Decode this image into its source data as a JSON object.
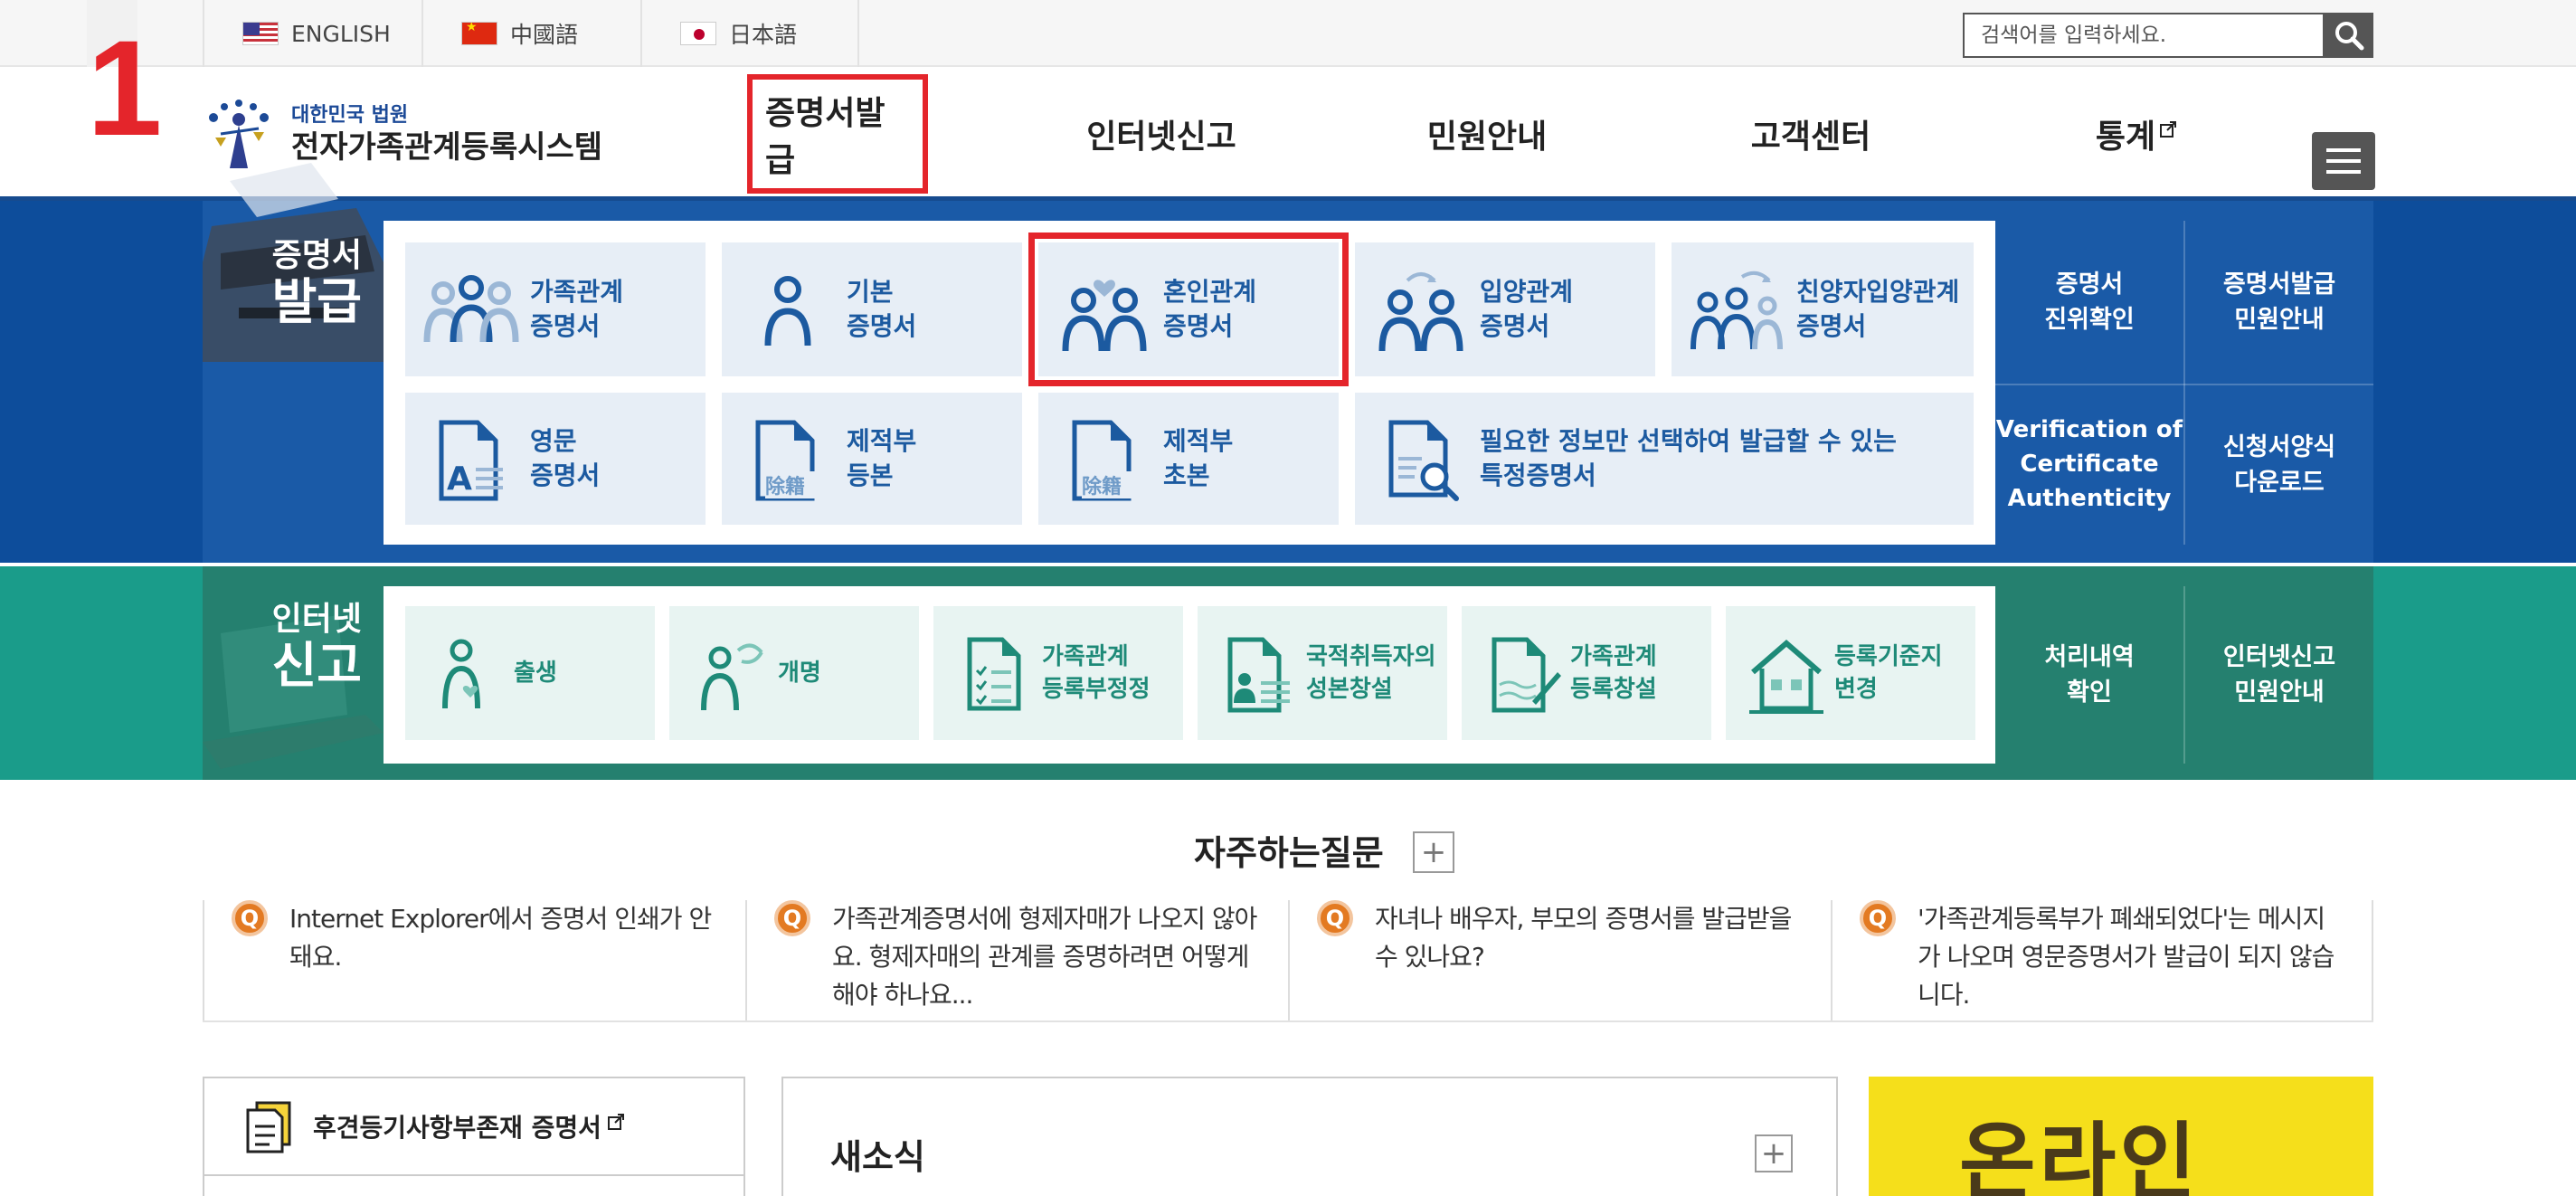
{
  "step_number": "1",
  "top": {
    "languages": [
      {
        "label": "ENGLISH",
        "flag": "us-flag-icon"
      },
      {
        "label": "中國語",
        "flag": "china-flag-icon"
      },
      {
        "label": "日本語",
        "flag": "japan-flag-icon"
      }
    ],
    "search": {
      "placeholder": "검색어를 입력하세요.",
      "icon": "search-icon"
    }
  },
  "header": {
    "logo_sub": "대한민국 법원",
    "logo_main": "전자가족관계등록시스템",
    "nav": [
      {
        "label": "증명서발급",
        "active": true
      },
      {
        "label": "인터넷신고",
        "active": false
      },
      {
        "label": "민원안내",
        "active": false
      },
      {
        "label": "고객센터",
        "active": false
      },
      {
        "label": "통계",
        "active": false,
        "external": true
      }
    ],
    "menu_icon": "hamburger-menu-icon"
  },
  "certificates": {
    "label_small": "증명서",
    "label_big": "발급",
    "tiles": [
      {
        "line1": "가족관계",
        "line2": "증명서",
        "icon": "family-icon",
        "selected": false
      },
      {
        "line1": "기본",
        "line2": "증명서",
        "icon": "person-icon",
        "selected": false
      },
      {
        "line1": "혼인관계",
        "line2": "증명서",
        "icon": "marriage-icon",
        "selected": true
      },
      {
        "line1": "입양관계",
        "line2": "증명서",
        "icon": "adoption-icon",
        "selected": false
      },
      {
        "line1": "친양자입양관계",
        "line2": "증명서",
        "icon": "full-adoption-icon",
        "selected": false
      },
      {
        "line1": "영문",
        "line2": "증명서",
        "icon": "english-document-icon",
        "selected": false
      },
      {
        "line1": "제적부",
        "line2": "등본",
        "icon": "removed-register-document-icon",
        "selected": false
      },
      {
        "line1": "제적부",
        "line2": "초본",
        "icon": "removed-register-abstract-icon",
        "selected": false
      },
      {
        "line1": "필요한 정보만 선택하여 발급할 수 있는",
        "line2": "특정증명서",
        "icon": "document-search-icon",
        "selected": false
      }
    ],
    "doc_stamp": "除籍",
    "side": [
      {
        "line1": "증명서",
        "line2": "진위확인"
      },
      {
        "line1": "증명서발급",
        "line2": "민원안내"
      },
      {
        "line1": "Verification of",
        "line2": "Certificate",
        "line3": "Authenticity"
      },
      {
        "line1": "신청서양식",
        "line2": "다운로드"
      }
    ]
  },
  "report": {
    "label_small": "인터넷",
    "label_big": "신고",
    "tiles": [
      {
        "line1": "출생",
        "line2": "",
        "icon": "birth-icon"
      },
      {
        "line1": "개명",
        "line2": "",
        "icon": "name-change-icon"
      },
      {
        "line1": "가족관계",
        "line2": "등록부정정",
        "icon": "checklist-document-icon"
      },
      {
        "line1": "국적취득자의",
        "line2": "성본창설",
        "icon": "id-card-icon"
      },
      {
        "line1": "가족관계",
        "line2": "등록창설",
        "icon": "document-edit-icon"
      },
      {
        "line1": "등록기준지",
        "line2": "변경",
        "icon": "house-icon"
      }
    ],
    "side": [
      {
        "line1": "처리내역",
        "line2": "확인"
      },
      {
        "line1": "인터넷신고",
        "line2": "민원안내"
      }
    ]
  },
  "faq": {
    "title": "자주하는질문",
    "more": "+",
    "q_badge": "Q",
    "items": [
      {
        "text": "Internet Explorer에서 증명서 인쇄가 안돼요."
      },
      {
        "text": "가족관계증명서에 형제자매가 나오지 않아요. 형제자매의 관계를 증명하려면 어떻게 해야 하나요..."
      },
      {
        "text": "자녀나 배우자, 부모의 증명서를 발급받을 수 있나요?"
      },
      {
        "text": "'가족관계등록부가 폐쇄되었다'는 메시지가 나오며 영문증명서가 발급이 되지 않습니다."
      }
    ]
  },
  "bottom": {
    "link_label": "후견등기사항부존재 증명서",
    "news_title": "새소식",
    "news_more": "+",
    "banner_text": "온라인"
  },
  "colors": {
    "accent_red": "#e4252b",
    "cert_blue": "#1a5aa7",
    "report_teal": "#25806f"
  }
}
